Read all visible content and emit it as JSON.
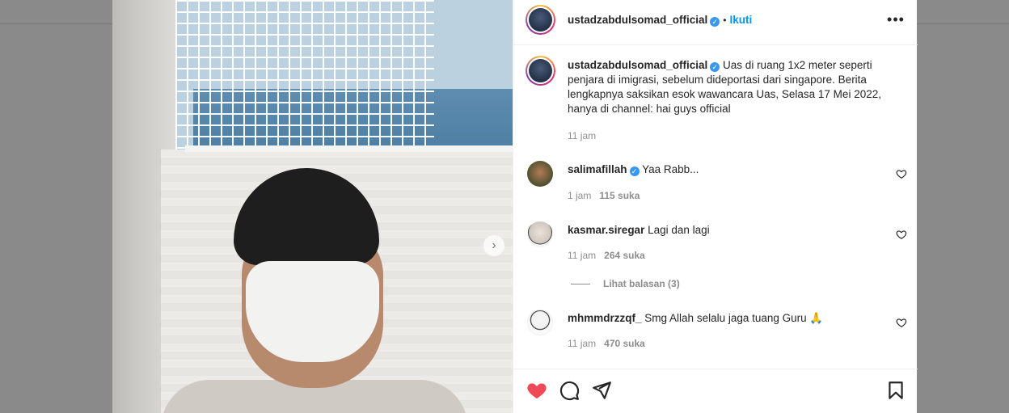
{
  "post": {
    "username": "ustadzabdulsomad_official",
    "follow_label": "Ikuti",
    "dot": "•",
    "more_label": "•••",
    "caption": "Uas di ruang 1x2 meter seperti penjara di imigrasi, sebelum dideportasi dari singapore. Berita lengkapnya saksikan esok wawancara Uas, Selasa 17 Mei 2022, hanya di channel: hai guys official",
    "caption_time": "11 jam"
  },
  "comments": [
    {
      "username": "salimafillah",
      "verified": true,
      "text": "Yaa Rabb...",
      "time": "1 jam",
      "likes": "115 suka"
    },
    {
      "username": "kasmar.siregar",
      "verified": false,
      "text": "Lagi dan lagi",
      "time": "11 jam",
      "likes": "264 suka"
    },
    {
      "username": "mhmmdrzzqf_",
      "verified": false,
      "text": "Smg Allah selalu jaga tuang Guru 🙏",
      "time": "11 jam",
      "likes": "470 suka"
    }
  ],
  "replies": {
    "label": "Lihat balasan (3)"
  },
  "carousel": {
    "next_glyph": "›"
  },
  "icons": {
    "like": "heart-filled-icon",
    "comment": "comment-bubble-icon",
    "share": "paper-plane-icon",
    "save": "bookmark-icon",
    "verified": "verified-badge-icon",
    "comment_like": "heart-outline-icon"
  },
  "colors": {
    "accent": "#0095f6",
    "like_red": "#ed4956",
    "verified": "#3897f0",
    "text": "#262626",
    "muted": "#8e8e8e"
  }
}
